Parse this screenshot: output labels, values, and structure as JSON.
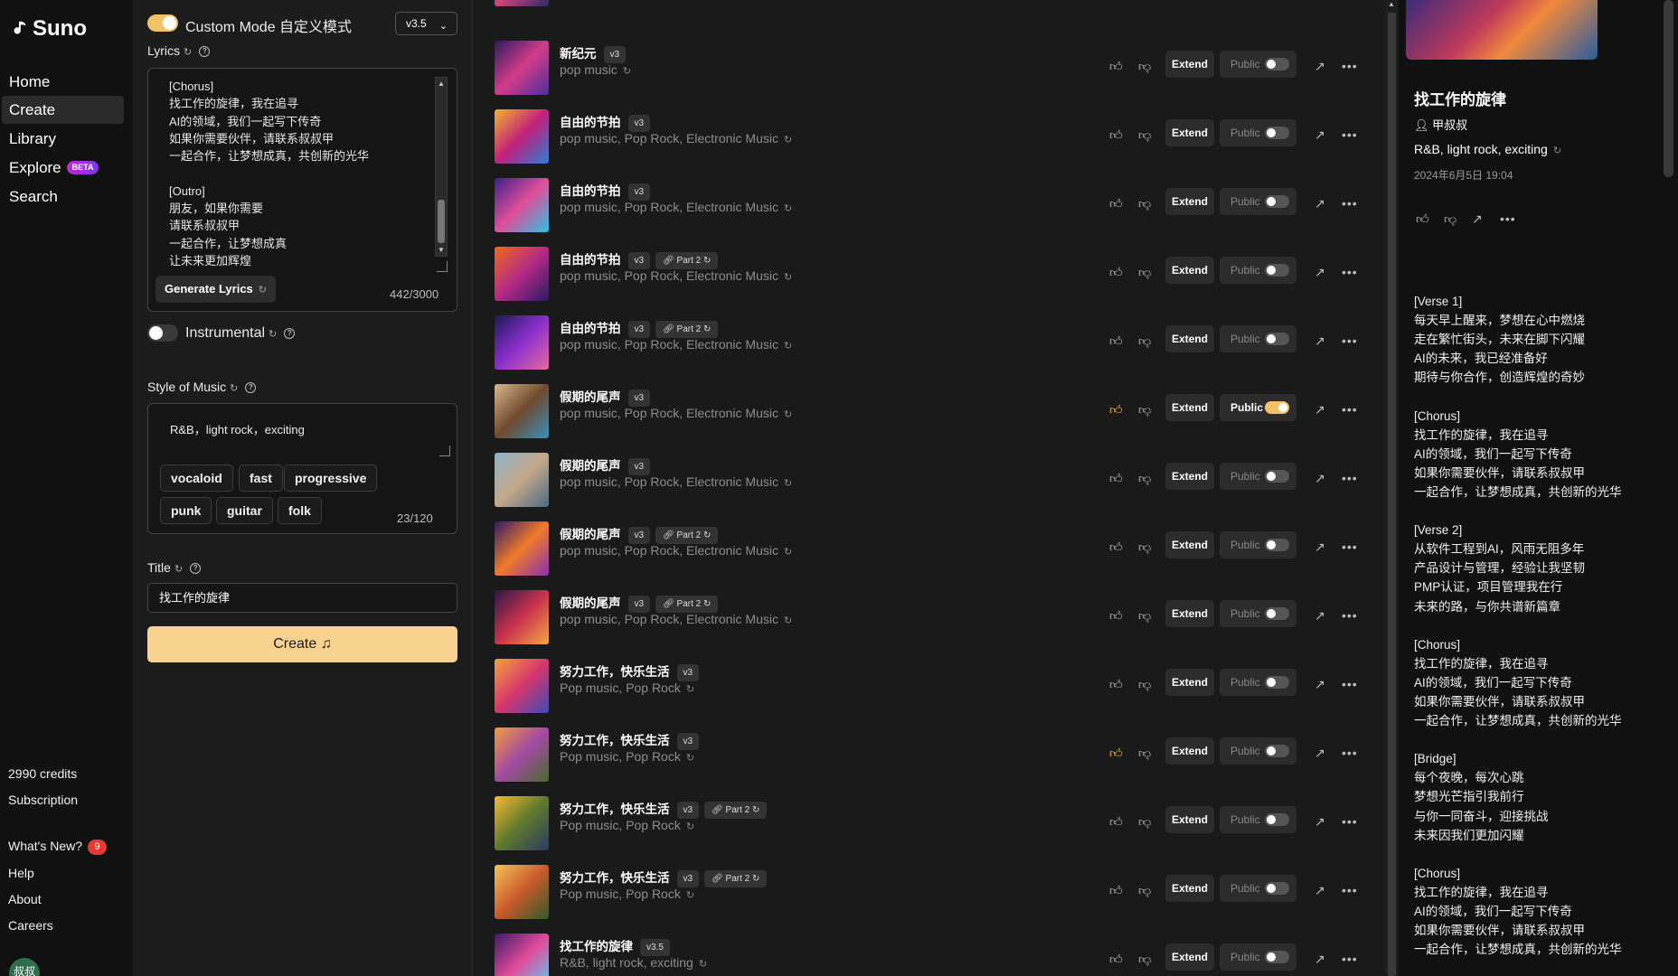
{
  "nav": {
    "brand": "Suno",
    "items": [
      {
        "label": "Home"
      },
      {
        "label": "Create"
      },
      {
        "label": "Library"
      },
      {
        "label": "Explore"
      },
      {
        "label": "Search"
      }
    ],
    "explore_badge": "BETA",
    "credits": "2990 credits",
    "subscription": "Subscription",
    "whats_new": "What's New?",
    "whats_new_count": "9",
    "help": "Help",
    "about": "About",
    "careers": "Careers",
    "avatar_text": "叔叔"
  },
  "create": {
    "custom_mode_label": "Custom Mode 自定义模式",
    "custom_mode_on": true,
    "version": "v3.5",
    "lyrics_label": "Lyrics",
    "lyrics_text": "[Chorus]\n找工作的旋律，我在追寻\nAI的领域，我们一起写下传奇\n如果你需要伙伴，请联系叔叔甲\n一起合作，让梦想成真，共创新的光华\n\n[Outro]\n朋友，如果你需要\n请联系叔叔甲\n一起合作，让梦想成真\n让未来更加辉煌",
    "generate_lyrics_label": "Generate Lyrics",
    "lyrics_count": "442/3000",
    "instrumental_label": "Instrumental",
    "style_label": "Style of Music",
    "style_value": "R&B，light rock，exciting",
    "style_tags": [
      "vocaloid",
      "fast",
      "progressive",
      "punk",
      "guitar",
      "folk"
    ],
    "style_count": "23/120",
    "title_label": "Title",
    "title_value": "找工作的旋律",
    "create_label": "Create"
  },
  "songs": [
    {
      "title": "新纪元",
      "version": "v3",
      "part": "",
      "style": "pop music",
      "liked": false,
      "public": false
    },
    {
      "title": "自由的节拍",
      "version": "v3",
      "part": "",
      "style": "pop music, Pop Rock, Electronic Music",
      "liked": false,
      "public": false
    },
    {
      "title": "自由的节拍",
      "version": "v3",
      "part": "",
      "style": "pop music, Pop Rock, Electronic Music",
      "liked": false,
      "public": false
    },
    {
      "title": "自由的节拍",
      "version": "v3",
      "part": "Part 2",
      "style": "pop music, Pop Rock, Electronic Music",
      "liked": false,
      "public": false
    },
    {
      "title": "自由的节拍",
      "version": "v3",
      "part": "Part 2",
      "style": "pop music, Pop Rock, Electronic Music",
      "liked": false,
      "public": false
    },
    {
      "title": "假期的尾声",
      "version": "v3",
      "part": "",
      "style": "pop music, Pop Rock, Electronic Music",
      "liked": true,
      "public": true
    },
    {
      "title": "假期的尾声",
      "version": "v3",
      "part": "",
      "style": "pop music, Pop Rock, Electronic Music",
      "liked": false,
      "public": false
    },
    {
      "title": "假期的尾声",
      "version": "v3",
      "part": "Part 2",
      "style": "pop music, Pop Rock, Electronic Music",
      "liked": false,
      "public": false
    },
    {
      "title": "假期的尾声",
      "version": "v3",
      "part": "Part 2",
      "style": "pop music, Pop Rock, Electronic Music",
      "liked": false,
      "public": false
    },
    {
      "title": "努力工作，快乐生活",
      "version": "v3",
      "part": "",
      "style": "Pop music, Pop Rock",
      "liked": false,
      "public": false
    },
    {
      "title": "努力工作，快乐生活",
      "version": "v3",
      "part": "",
      "style": "Pop music, Pop Rock",
      "liked": true,
      "public": false
    },
    {
      "title": "努力工作，快乐生活",
      "version": "v3",
      "part": "Part 2",
      "style": "Pop music, Pop Rock",
      "liked": false,
      "public": false
    },
    {
      "title": "努力工作，快乐生活",
      "version": "v3",
      "part": "Part 2",
      "style": "Pop music, Pop Rock",
      "liked": false,
      "public": false
    },
    {
      "title": "找工作的旋律",
      "version": "v3.5",
      "part": "",
      "style": "R&B, light rock, exciting",
      "liked": false,
      "public": false
    }
  ],
  "row_labels": {
    "extend": "Extend",
    "public": "Public"
  },
  "detail": {
    "title": "找工作的旋律",
    "author": "甲叔叔",
    "style": "R&B, light rock, exciting",
    "date": "2024年6月5日 19:04",
    "lyrics": "[Verse 1]\n每天早上醒来，梦想在心中燃烧\n走在繁忙街头，未来在脚下闪耀\nAI的未来，我已经准备好\n期待与你合作，创造辉煌的奇妙\n\n[Chorus]\n找工作的旋律，我在追寻\nAI的领域，我们一起写下传奇\n如果你需要伙伴，请联系叔叔甲\n一起合作，让梦想成真，共创新的光华\n\n[Verse 2]\n从软件工程到AI，风雨无阻多年\n产品设计与管理，经验让我坚韧\nPMP认证，项目管理我在行\n未来的路，与你共谱新篇章\n\n[Chorus]\n找工作的旋律，我在追寻\nAI的领域，我们一起写下传奇\n如果你需要伙伴，请联系叔叔甲\n一起合作，让梦想成真，共创新的光华\n\n[Bridge]\n每个夜晚，每次心跳\n梦想光芒指引我前行\n与你一同奋斗，迎接挑战\n未来因我们更加闪耀\n\n[Chorus]\n找工作的旋律，我在追寻\nAI的领域，我们一起写下传奇\n如果你需要伙伴，请联系叔叔甲\n一起合作，让梦想成真，共创新的光华"
  }
}
